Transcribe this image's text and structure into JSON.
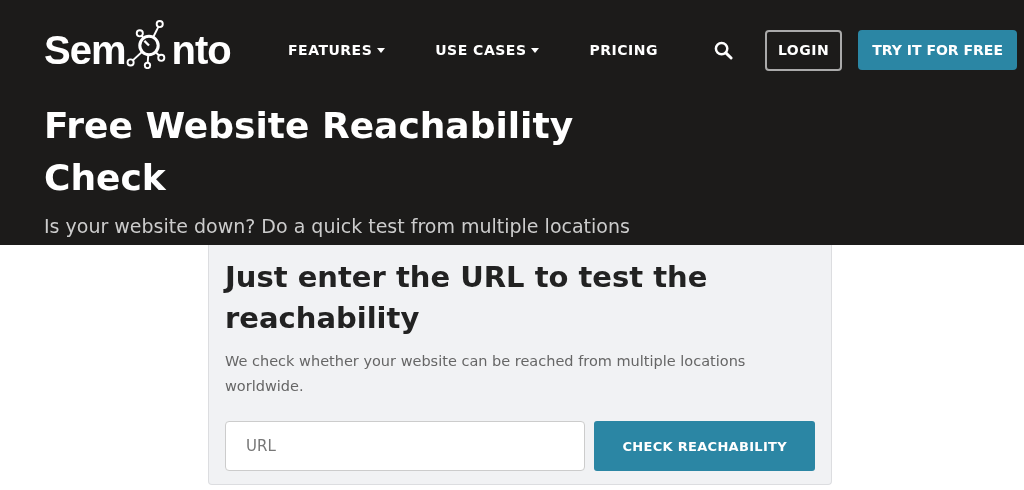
{
  "logo": {
    "before": "Sem",
    "after": "nto"
  },
  "nav": [
    {
      "label": "FEATURES",
      "has_menu": true
    },
    {
      "label": "USE CASES",
      "has_menu": true
    },
    {
      "label": "PRICING",
      "has_menu": false
    }
  ],
  "login": "LOGIN",
  "cta": "TRY IT FOR FREE",
  "hero": {
    "title": "Free Website Reachability Check",
    "subtitle": "Is your website down? Do a quick test from multiple locations"
  },
  "card": {
    "heading": "Just enter the URL to test the reachability",
    "text": "We check whether your website can be reached from multiple locations worldwide.",
    "placeholder": "URL",
    "button": "CHECK REACHABILITY"
  }
}
